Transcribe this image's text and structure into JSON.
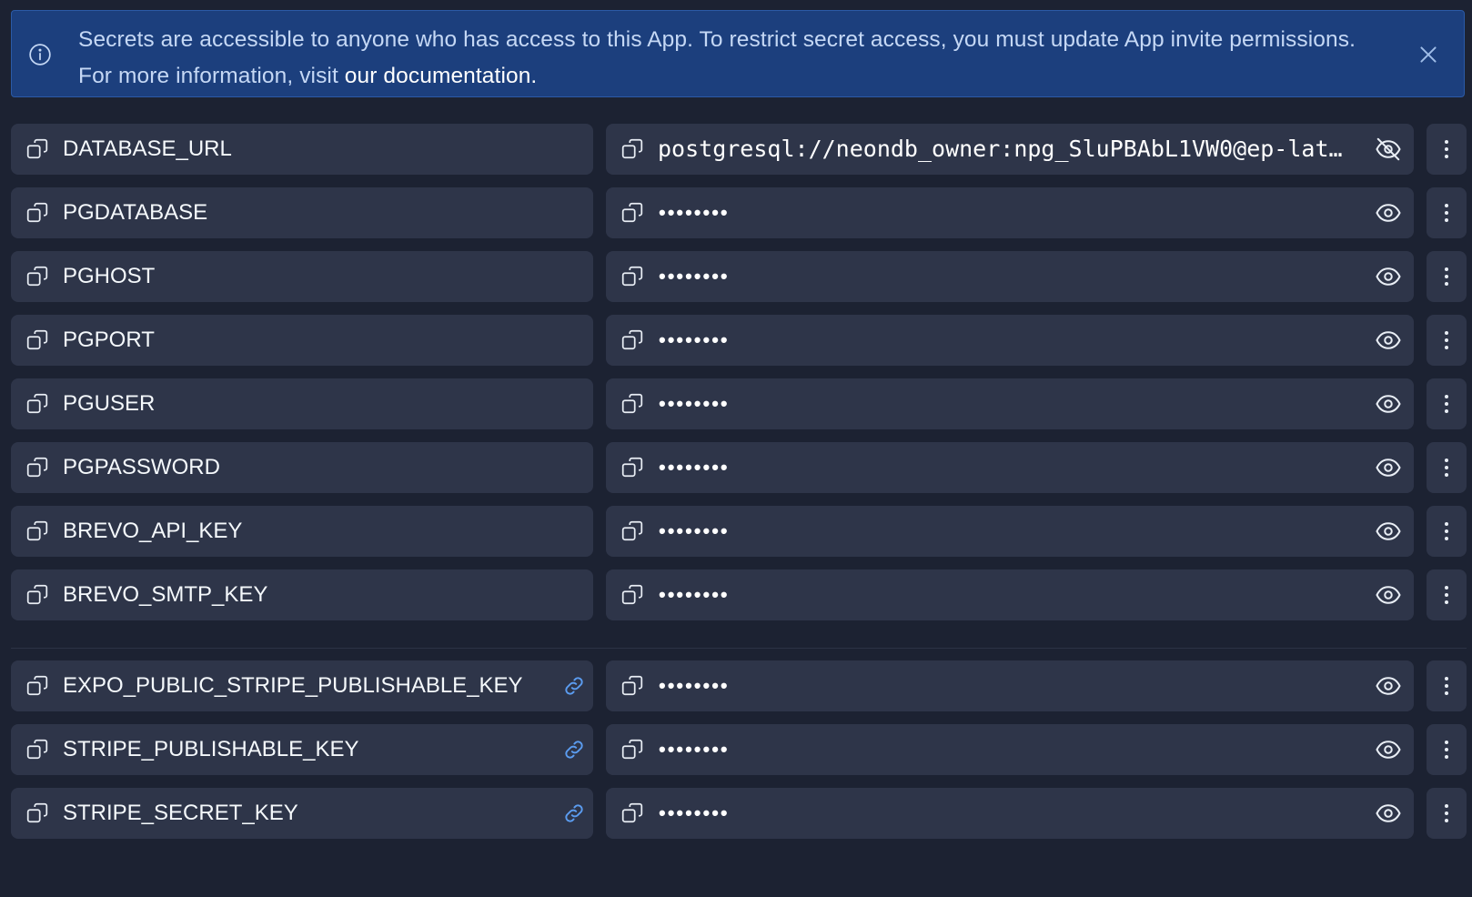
{
  "banner": {
    "message_line1": "Secrets are accessible to anyone who has access to this App. To restrict secret access, you must update App invite permissions.",
    "message_line2_prefix": "For more information, visit ",
    "message_link": "our documentation.",
    "icon": "info-icon",
    "close_icon": "close-icon"
  },
  "secrets": [
    {
      "key": "DATABASE_URL",
      "value": "postgresql://neondb_owner:npg_SluPBAbL1VW0@ep-lat…",
      "revealed": true,
      "linked": false
    },
    {
      "key": "PGDATABASE",
      "value": "••••••••",
      "revealed": false,
      "linked": false
    },
    {
      "key": "PGHOST",
      "value": "••••••••",
      "revealed": false,
      "linked": false
    },
    {
      "key": "PGPORT",
      "value": "••••••••",
      "revealed": false,
      "linked": false
    },
    {
      "key": "PGUSER",
      "value": "••••••••",
      "revealed": false,
      "linked": false
    },
    {
      "key": "PGPASSWORD",
      "value": "••••••••",
      "revealed": false,
      "linked": false
    },
    {
      "key": "BREVO_API_KEY",
      "value": "••••••••",
      "revealed": false,
      "linked": false
    },
    {
      "key": "BREVO_SMTP_KEY",
      "value": "••••••••",
      "revealed": false,
      "linked": false
    },
    {
      "key": "EXPO_PUBLIC_STRIPE_PUBLISHABLE_KEY",
      "value": "••••••••",
      "revealed": false,
      "linked": true
    },
    {
      "key": "STRIPE_PUBLISHABLE_KEY",
      "value": "••••••••",
      "revealed": false,
      "linked": true
    },
    {
      "key": "STRIPE_SECRET_KEY",
      "value": "••••••••",
      "revealed": false,
      "linked": true
    }
  ],
  "colors": {
    "background": "#1c2232",
    "row_background": "#2e3549",
    "banner_background": "#1c3f7d",
    "link_icon": "#5b9cf0",
    "icon": "#e9eef5"
  }
}
